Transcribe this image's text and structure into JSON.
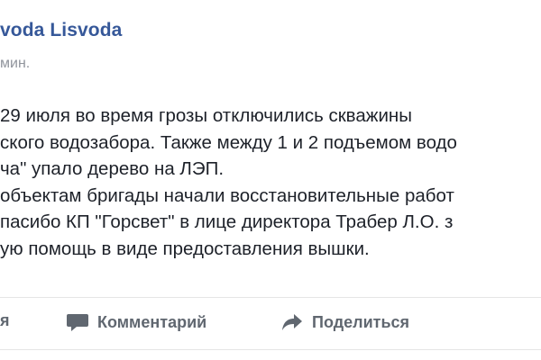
{
  "post": {
    "author": "voda Lisvoda",
    "timestamp": "мин.",
    "lines": [
      "29 июля во время грозы отключились скважины",
      "ского водозабора. Также между 1 и 2 подъемом водо",
      "ча\" упало дерево на ЛЭП.",
      "объектам бригады начали восстановительные работ",
      "пасибо КП \"Горсвет\" в лице директора Трабер Л.О. з",
      "ую помощь в виде предоставления вышки."
    ]
  },
  "actions": {
    "like_label": "я",
    "comment_label": "Комментарий",
    "share_label": "Поделиться",
    "comment_icon": "comment-bubble-icon",
    "share_icon": "share-arrow-icon"
  },
  "colors": {
    "author": "#365899",
    "text": "#1d2129",
    "meta": "#90949c",
    "action": "#606770"
  }
}
